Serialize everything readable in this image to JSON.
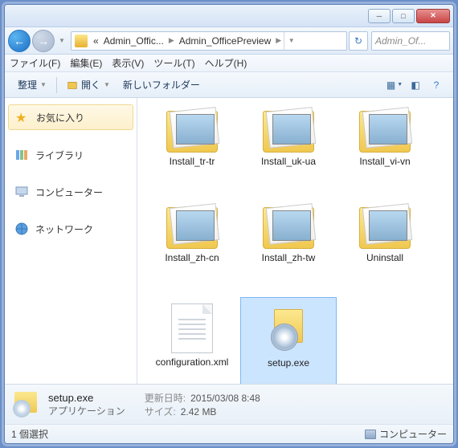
{
  "breadcrumb": {
    "p1": "«",
    "p2": "Admin_Offic...",
    "p3": "Admin_OfficePreview"
  },
  "search": {
    "placeholder": "Admin_Of..."
  },
  "menu": {
    "file": "ファイル(F)",
    "edit": "編集(E)",
    "view": "表示(V)",
    "tool": "ツール(T)",
    "help": "ヘルプ(H)"
  },
  "toolbar": {
    "organize": "整理",
    "open": "開く",
    "newfolder": "新しいフォルダー"
  },
  "sidebar": {
    "fav": "お気に入り",
    "lib": "ライブラリ",
    "comp": "コンピューター",
    "net": "ネットワーク"
  },
  "items": {
    "f0": "Install_tr-tr",
    "f1": "Install_uk-ua",
    "f2": "Install_vi-vn",
    "f3": "Install_zh-cn",
    "f4": "Install_zh-tw",
    "f5": "Uninstall",
    "file0": "configuration.xml",
    "file1": "setup.exe"
  },
  "details": {
    "name": "setup.exe",
    "type": "アプリケーション",
    "date_lbl": "更新日時:",
    "date": "2015/03/08 8:48",
    "size_lbl": "サイズ:",
    "size": "2.42 MB"
  },
  "status": {
    "sel": "1 個選択",
    "comp": "コンピューター"
  }
}
